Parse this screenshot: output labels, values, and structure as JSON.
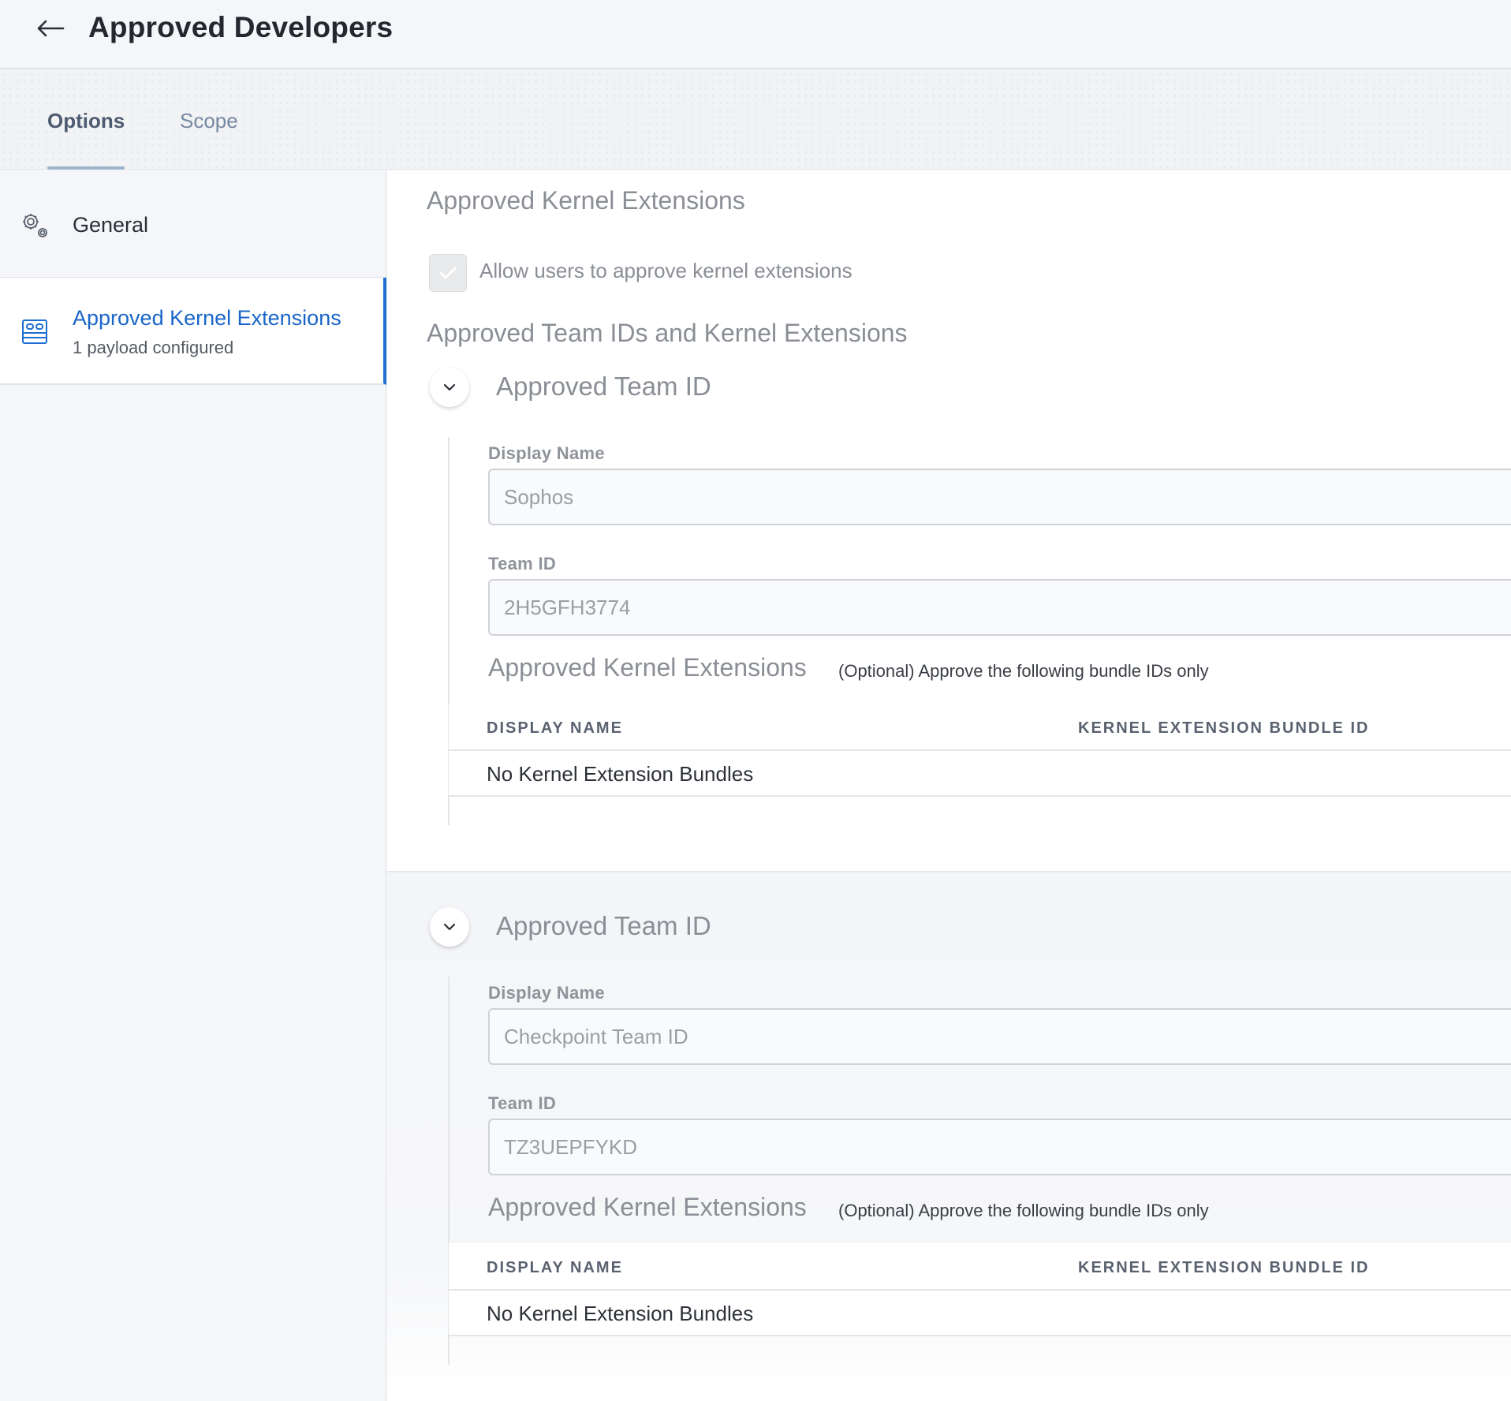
{
  "header": {
    "title": "Approved Developers",
    "back_icon": "arrow-left-icon"
  },
  "tabs": [
    {
      "label": "Options",
      "active": true
    },
    {
      "label": "Scope",
      "active": false
    }
  ],
  "sidebar": {
    "items": [
      {
        "label": "General",
        "icon": "gear-icon"
      },
      {
        "label": "Approved Kernel Extensions",
        "sub": "1 payload configured",
        "icon": "kernel-extensions-icon",
        "active": true
      }
    ]
  },
  "main": {
    "heading": "Approved Kernel Extensions",
    "allow_users_label": "Allow users to approve kernel extensions",
    "allow_users_checked": true,
    "team_ids_heading": "Approved Team IDs and Kernel Extensions",
    "teams": [
      {
        "title": "Approved Team ID",
        "display_name_label": "Display Name",
        "display_name_value": "Sophos",
        "team_id_label": "Team ID",
        "team_id_value": "2H5GFH3774",
        "extensions_title": "Approved Kernel Extensions",
        "extensions_hint": "(Optional) Approve the following bundle IDs only",
        "columns": [
          "DISPLAY NAME",
          "KERNEL EXTENSION BUNDLE ID"
        ],
        "empty_text": "No Kernel Extension Bundles"
      },
      {
        "title": "Approved Team ID",
        "display_name_label": "Display Name",
        "display_name_value": "Checkpoint Team ID",
        "team_id_label": "Team ID",
        "team_id_value": "TZ3UEPFYKD",
        "extensions_title": "Approved Kernel Extensions",
        "extensions_hint": "(Optional) Approve the following bundle IDs only",
        "columns": [
          "DISPLAY NAME",
          "KERNEL EXTENSION BUNDLE ID"
        ],
        "empty_text": "No Kernel Extension Bundles"
      }
    ]
  },
  "colors": {
    "accent": "#1e6fd1",
    "tab_active": "#4d5b70",
    "tab_inactive": "#7588a2"
  }
}
